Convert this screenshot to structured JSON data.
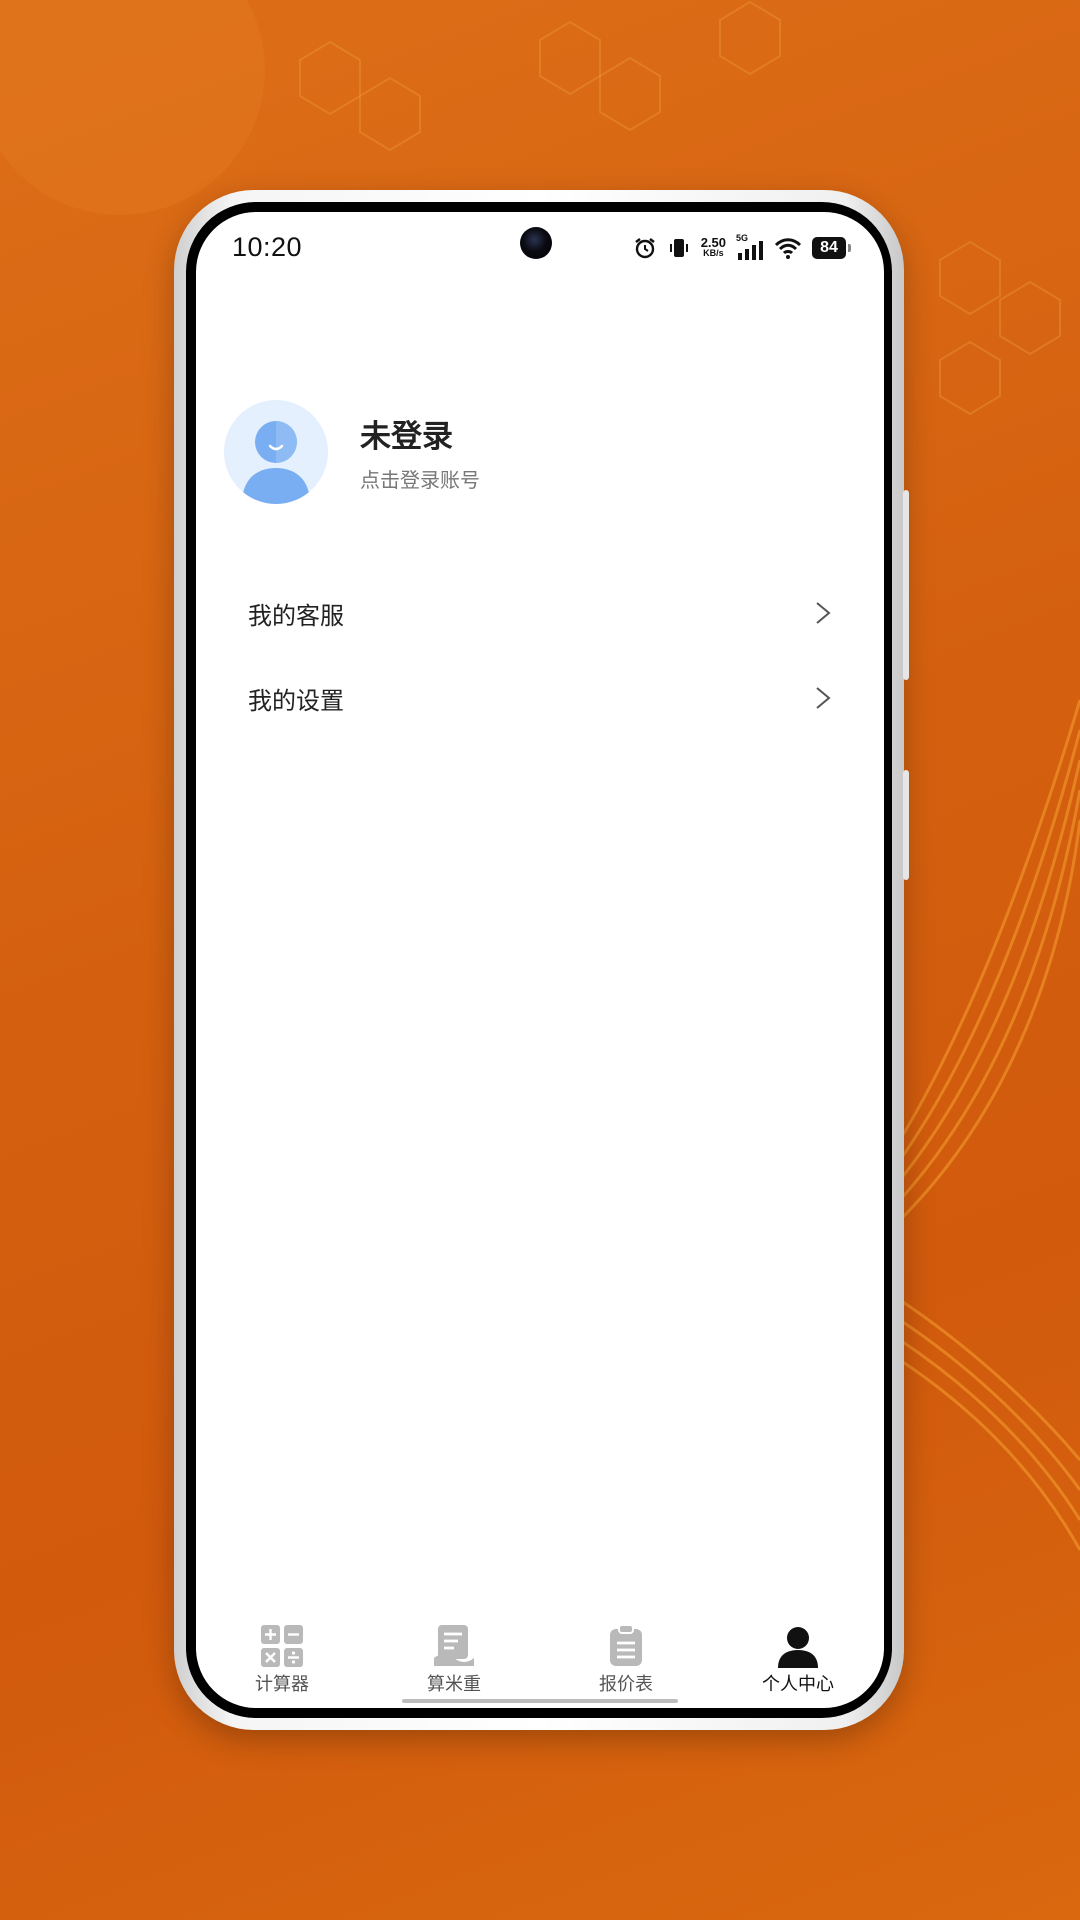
{
  "status_bar": {
    "time": "10:20",
    "net_speed_value": "2.50",
    "net_speed_unit": "KB/s",
    "network_type": "5G",
    "battery": "84"
  },
  "profile": {
    "title": "未登录",
    "subtitle": "点击登录账号"
  },
  "menu": {
    "items": [
      {
        "label": "我的客服"
      },
      {
        "label": "我的设置"
      }
    ]
  },
  "tabbar": {
    "items": [
      {
        "label": "计算器",
        "icon": "calculator-icon"
      },
      {
        "label": "算米重",
        "icon": "document-icon"
      },
      {
        "label": "报价表",
        "icon": "clipboard-icon"
      },
      {
        "label": "个人中心",
        "icon": "person-icon",
        "active": true
      }
    ]
  },
  "colors": {
    "background": "#d4600f",
    "avatar_bg": "#e4f0fd",
    "avatar_figure": "#7aaef2",
    "tab_inactive_icon": "#b9b9b9",
    "tab_active_icon": "#111111"
  }
}
